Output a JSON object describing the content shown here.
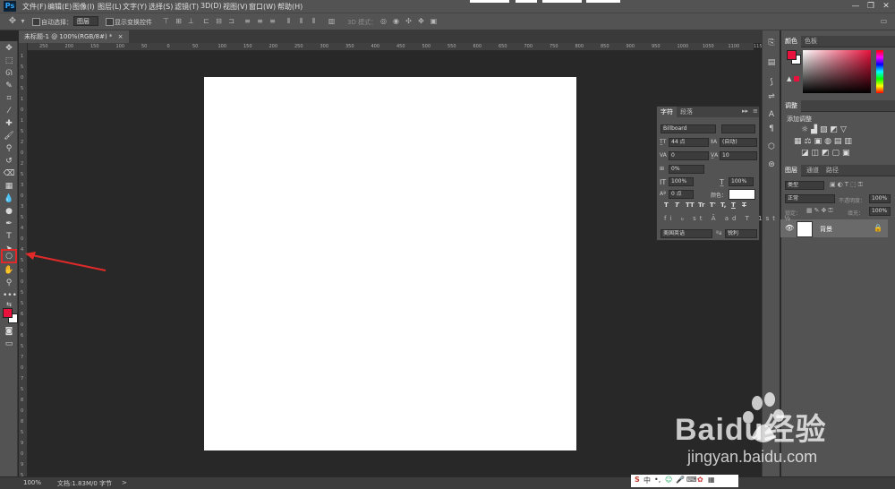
{
  "app": {
    "logo": "Ps"
  },
  "menu": {
    "items": [
      "文件(F)",
      "编辑(E)",
      "图像(I)",
      "图层(L)",
      "文字(Y)",
      "选择(S)",
      "滤镜(T)",
      "3D(D)",
      "视图(V)",
      "窗口(W)",
      "帮助(H)"
    ]
  },
  "options_bar": {
    "auto_select_label": "自动选择：",
    "auto_select_value": "图层",
    "show_transform_label": "显示变换控件",
    "mode_3d_label": "3D 模式："
  },
  "document": {
    "tab_title": "未标题-1 @ 100%(RGB/8#) *",
    "close_glyph": "×"
  },
  "ruler": {
    "h_labels": [
      "250",
      "200",
      "150",
      "100",
      "50",
      "0",
      "50",
      "100",
      "150",
      "200",
      "250",
      "300",
      "350",
      "400",
      "450",
      "500",
      "550",
      "600",
      "650",
      "700",
      "750",
      "800",
      "850",
      "900",
      "950",
      "1000",
      "1050",
      "1100",
      "1150"
    ],
    "v_labels": [
      "1",
      "5",
      "0",
      "5",
      "1",
      "0",
      "1",
      "5",
      "2",
      "0",
      "2",
      "5",
      "3",
      "0",
      "3",
      "5",
      "4",
      "0",
      "4",
      "5",
      "5",
      "0",
      "5",
      "5",
      "6",
      "0",
      "6",
      "5",
      "7",
      "0",
      "7",
      "5",
      "8",
      "0",
      "8",
      "5",
      "9",
      "0",
      "9",
      "5"
    ]
  },
  "status": {
    "zoom": "100%",
    "doc_info": "文档:1.83M/0 字节",
    "arrow": ">"
  },
  "character_panel": {
    "tab_character": "字符",
    "tab_paragraph": "段落",
    "font_family": "Billboard",
    "font_size": "44 点",
    "leading": "(自动)",
    "kerning": "0",
    "tracking": "10",
    "baseline_shift_percent": "0%",
    "vertical_scale": "100%",
    "horizontal_scale": "100%",
    "baseline_shift": "0 点",
    "color_label": "颜色：",
    "language": "美国英语",
    "antialias": "锐利",
    "type_buttons": [
      "T",
      "T",
      "TT",
      "Tr",
      "T'",
      "T,",
      "T",
      "T"
    ]
  },
  "color_panel": {
    "tab_color": "颜色",
    "tab_swatches": "色板",
    "foreground": "#e8123c",
    "background": "#ffffff"
  },
  "adjustments_panel": {
    "tab": "调整",
    "add_label": "添加调整"
  },
  "layers_panel": {
    "tab_layers": "图层",
    "tab_channels": "通道",
    "tab_paths": "路径",
    "filter_kind": "类型",
    "blend_mode": "正常",
    "opacity_label": "不透明度：",
    "opacity_value": "100%",
    "lock_label": "锁定：",
    "fill_label": "填充：",
    "fill_value": "100%",
    "layer_name": "背景"
  },
  "watermark": {
    "brand": "Baidu经验",
    "url": "jingyan.baidu.com"
  },
  "colors": {
    "ui_bg": "#535353",
    "workspace": "#282828",
    "highlight": "#e02a2a",
    "fg_color": "#e8123c"
  }
}
